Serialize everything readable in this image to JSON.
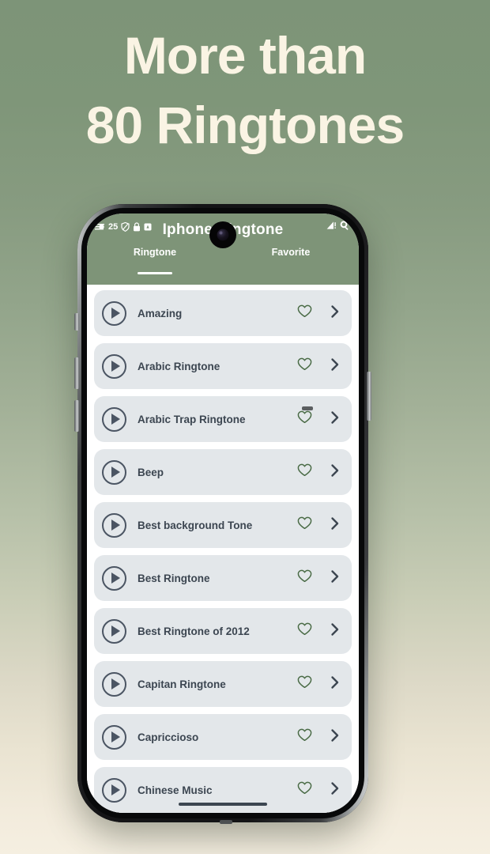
{
  "headline": {
    "line1": "More than",
    "line2": "80 Ringtones",
    "color": "#faf4e4"
  },
  "background": {
    "gradient_top": "#7d9478",
    "gradient_bottom": "#f5efe1"
  },
  "phone": {
    "status_bar": {
      "notification_count": "25",
      "left_icons": [
        "notification-lines-icon",
        "shield-icon",
        "lock-icon",
        "app-badge-icon"
      ],
      "right_icons": [
        "signal-warning-icon",
        "search-icon"
      ]
    },
    "app": {
      "title": "Iphone Ringtone",
      "header_color": "#7e9478",
      "tabs": [
        {
          "label": "Ringtone",
          "active": true
        },
        {
          "label": "Favorite",
          "active": false
        }
      ],
      "rows": [
        {
          "title": "Amazing"
        },
        {
          "title": "Arabic Ringtone"
        },
        {
          "title": "Arabic Trap Ringtone"
        },
        {
          "title": "Beep"
        },
        {
          "title": "Best background Tone"
        },
        {
          "title": "Best Ringtone"
        },
        {
          "title": "Best Ringtone of 2012"
        },
        {
          "title": "Capitan Ringtone"
        },
        {
          "title": "Capriccioso"
        },
        {
          "title": "Chinese Music"
        }
      ],
      "row_icons": {
        "play": "play-icon",
        "favorite": "heart-outline-icon",
        "open": "chevron-right-icon"
      },
      "colors": {
        "row_background": "#e3e7ea",
        "row_text": "#3c4651",
        "heart_outline": "#4a6b46",
        "play_outline": "#4b5563"
      }
    }
  }
}
